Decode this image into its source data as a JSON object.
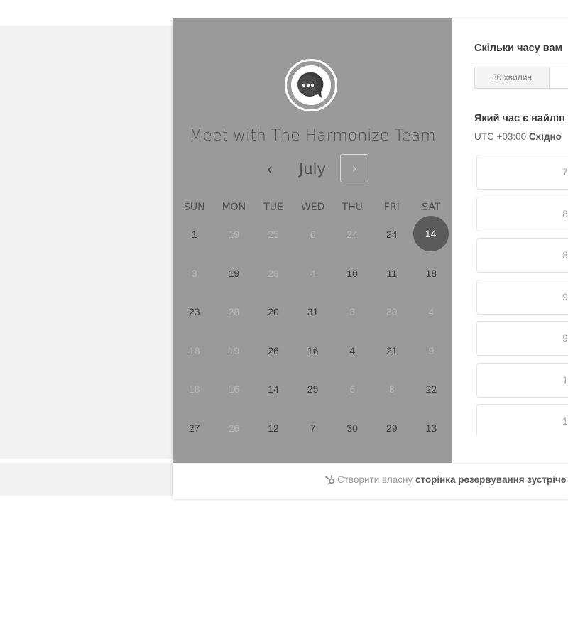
{
  "calendar": {
    "title": "Meet with The Harmonize Team",
    "month": "July",
    "prev_symbol": "‹",
    "next_symbol": "›",
    "weekdays": [
      "SUN",
      "MON",
      "TUE",
      "WED",
      "THU",
      "FRI",
      "SAT"
    ],
    "weeks": [
      [
        {
          "d": "1",
          "a": true
        },
        {
          "d": "19",
          "a": false
        },
        {
          "d": "25",
          "a": false
        },
        {
          "d": "6",
          "a": false
        },
        {
          "d": "24",
          "a": false
        },
        {
          "d": "24",
          "a": true
        },
        {
          "d": "14",
          "a": true,
          "sel": true
        }
      ],
      [
        {
          "d": "3",
          "a": false
        },
        {
          "d": "19",
          "a": true
        },
        {
          "d": "28",
          "a": false
        },
        {
          "d": "4",
          "a": false
        },
        {
          "d": "10",
          "a": true
        },
        {
          "d": "11",
          "a": true
        },
        {
          "d": "18",
          "a": true
        }
      ],
      [
        {
          "d": "23",
          "a": true
        },
        {
          "d": "28",
          "a": false
        },
        {
          "d": "20",
          "a": true
        },
        {
          "d": "31",
          "a": true
        },
        {
          "d": "3",
          "a": false
        },
        {
          "d": "30",
          "a": false
        },
        {
          "d": "4",
          "a": false
        }
      ],
      [
        {
          "d": "18",
          "a": false
        },
        {
          "d": "19",
          "a": false
        },
        {
          "d": "26",
          "a": true
        },
        {
          "d": "16",
          "a": true
        },
        {
          "d": "4",
          "a": true
        },
        {
          "d": "21",
          "a": true
        },
        {
          "d": "9",
          "a": false
        }
      ],
      [
        {
          "d": "18",
          "a": false
        },
        {
          "d": "16",
          "a": false
        },
        {
          "d": "14",
          "a": true
        },
        {
          "d": "25",
          "a": true
        },
        {
          "d": "6",
          "a": false
        },
        {
          "d": "8",
          "a": false
        },
        {
          "d": "22",
          "a": true
        }
      ],
      [
        {
          "d": "27",
          "a": true
        },
        {
          "d": "26",
          "a": false
        },
        {
          "d": "12",
          "a": true
        },
        {
          "d": "7",
          "a": true
        },
        {
          "d": "30",
          "a": true
        },
        {
          "d": "29",
          "a": true
        },
        {
          "d": "13",
          "a": true
        }
      ]
    ]
  },
  "booking": {
    "duration_question": "Скільки часу вам",
    "duration_option": "30 хвилин",
    "time_question": "Який час є найліп",
    "timezone_prefix": "UTC +03:00",
    "timezone_name": "Східно",
    "slots": [
      "7",
      "8",
      "8",
      "9",
      "9",
      "1(",
      "1("
    ]
  },
  "footer": {
    "link_text": "Створити власну",
    "link_bold": "сторінка резервування зустріче"
  },
  "colors": {
    "calendar_bg": "#9a9a9a",
    "selected_day": "#5b5b5b"
  }
}
